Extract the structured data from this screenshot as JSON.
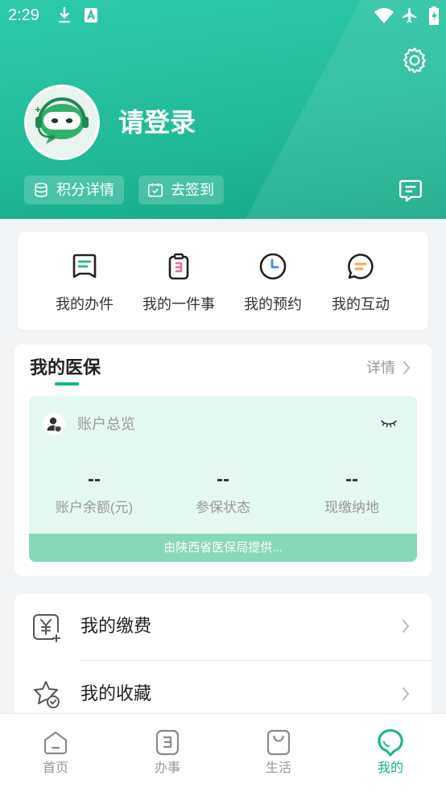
{
  "status_bar": {
    "time": "2:29"
  },
  "header": {
    "login_prompt": "请登录",
    "points_button": "积分详情",
    "checkin_button": "去签到"
  },
  "quick_actions": [
    {
      "label": "我的办件",
      "icon": "document-icon",
      "accent": "#1bb98f"
    },
    {
      "label": "我的一件事",
      "icon": "clipboard-icon",
      "accent": "#f26a8d"
    },
    {
      "label": "我的预约",
      "icon": "clock-icon",
      "accent": "#3b8df2"
    },
    {
      "label": "我的互动",
      "icon": "chat-bubble-icon",
      "accent": "#f7a23e"
    }
  ],
  "medical_insurance": {
    "title": "我的医保",
    "details_link": "详情",
    "overview_label": "账户总览",
    "stats": [
      {
        "value": "--",
        "label": "账户余额(元)"
      },
      {
        "value": "--",
        "label": "参保状态"
      },
      {
        "value": "--",
        "label": "现缴纳地"
      }
    ],
    "provider_note": "由陕西省医保局提供..."
  },
  "menu": [
    {
      "label": "我的缴费",
      "icon": "yen-payment-icon"
    },
    {
      "label": "我的收藏",
      "icon": "star-favorite-icon"
    }
  ],
  "tab_bar": [
    {
      "label": "首页",
      "icon": "home-icon",
      "active": false
    },
    {
      "label": "办事",
      "icon": "tasks-icon",
      "active": false
    },
    {
      "label": "生活",
      "icon": "shopping-bag-icon",
      "active": false
    },
    {
      "label": "我的",
      "icon": "profile-icon",
      "active": true
    }
  ],
  "colors": {
    "header_top": "#2ecaa9",
    "header_bottom": "#15a886",
    "accent": "#13b589",
    "overview_background": "#e6f8f2",
    "provider_bar": "#87d8b8"
  }
}
